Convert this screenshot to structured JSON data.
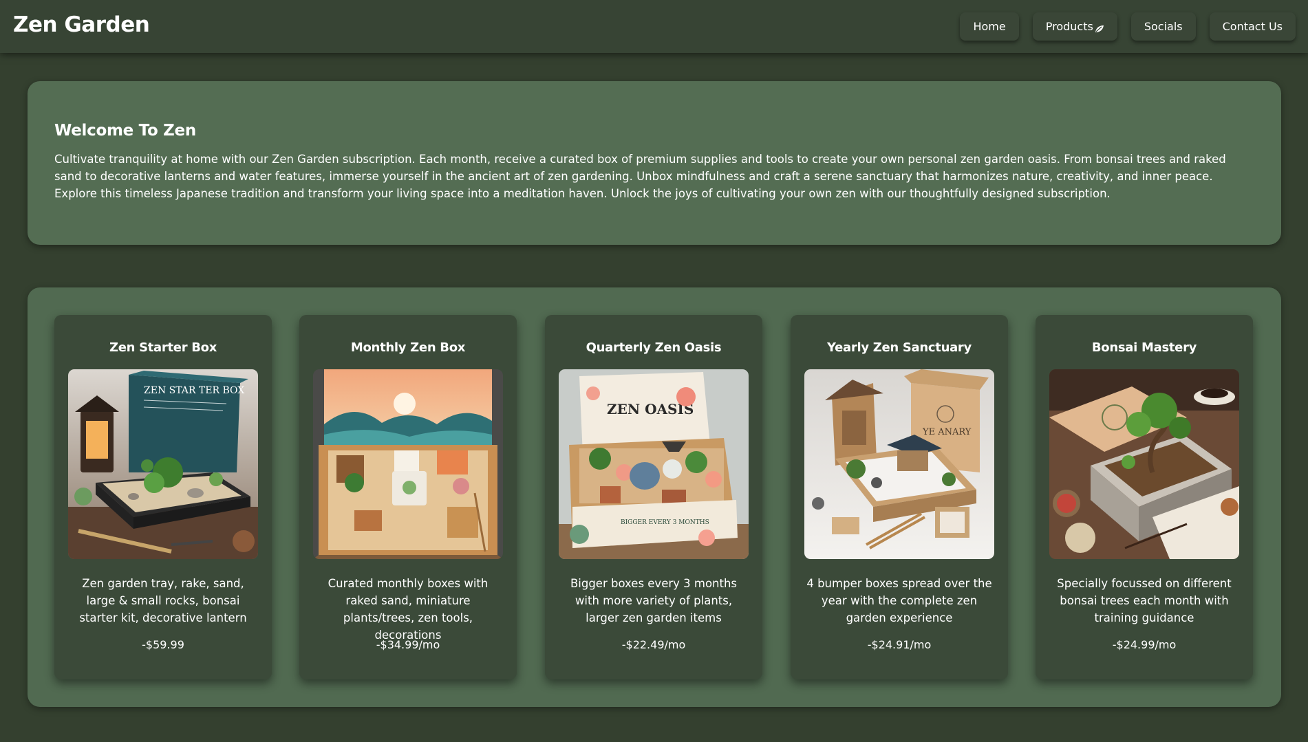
{
  "header": {
    "brand": "Zen Garden",
    "nav": [
      {
        "label": "Home",
        "icon": ""
      },
      {
        "label": "Products",
        "icon": "leaf-icon"
      },
      {
        "label": "Socials",
        "icon": ""
      },
      {
        "label": "Contact Us",
        "icon": ""
      }
    ]
  },
  "welcome": {
    "title": "Welcome To Zen",
    "body": "Cultivate tranquility at home with our Zen Garden subscription. Each month, receive a curated box of premium supplies and tools to create your own personal zen garden oasis. From bonsai trees and raked sand to decorative lanterns and water features, immerse yourself in the ancient art of zen gardening. Unbox mindfulness and craft a serene sanctuary that harmonizes nature, creativity, and inner peace. Explore this timeless Japanese tradition and transform your living space into a meditation haven. Unlock the joys of cultivating your own zen with our thoughtfully designed subscription."
  },
  "products": [
    {
      "title": "Zen Starter Box",
      "description": "Zen garden tray, rake, sand, large & small rocks, bonsai starter kit, decorative lantern",
      "price": "-$59.99",
      "image_text": "ZEN STAR TER BOX"
    },
    {
      "title": "Monthly Zen Box",
      "description": "Curated monthly boxes with raked sand, miniature plants/trees, zen tools, decorations",
      "price": "-$34.99/mo",
      "image_text": ""
    },
    {
      "title": "Quarterly Zen Oasis",
      "description": "Bigger boxes every 3 months with more variety of plants, larger zen garden items",
      "price": "-$22.49/mo",
      "image_text": "ZEN OASIS"
    },
    {
      "title": "Yearly Zen Sanctuary",
      "description": "4 bumper boxes spread over the year with the complete zen garden experience",
      "price": "-$24.91/mo",
      "image_text": "YE ANARY"
    },
    {
      "title": "Bonsai Mastery",
      "description": "Specially focussed on different bonsai trees each month with training guidance",
      "price": "-$24.99/mo",
      "image_text": ""
    }
  ],
  "colors": {
    "page_bg": "#34402f",
    "header_bg": "#374434",
    "panel_bg": "#546d53",
    "card_bg": "#3b4a39",
    "text": "#ffffff"
  }
}
